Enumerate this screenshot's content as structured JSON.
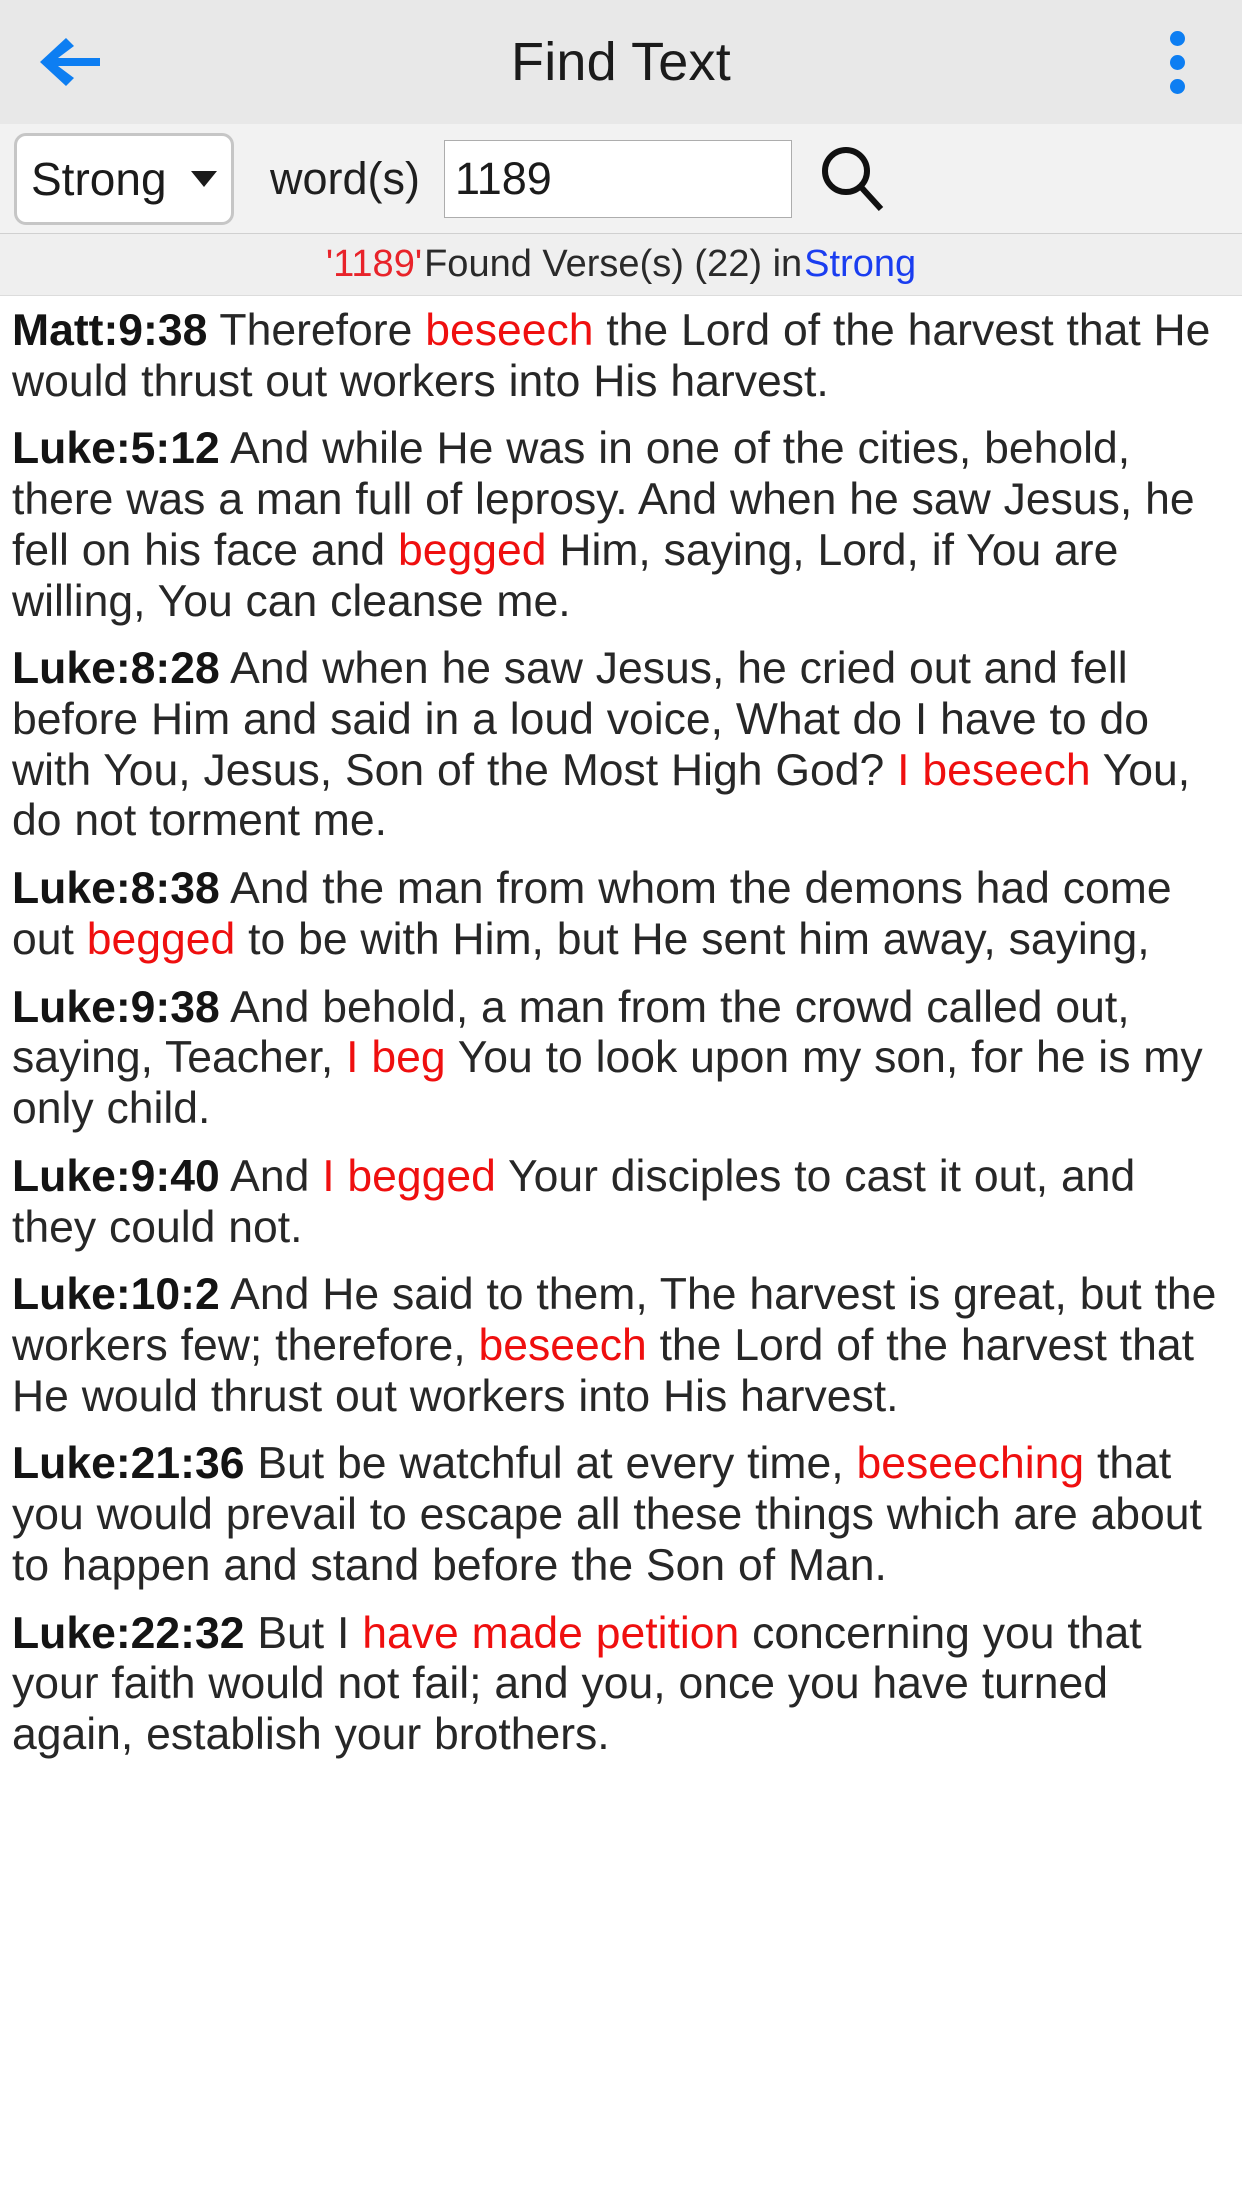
{
  "appbar": {
    "title": "Find Text",
    "back_icon": "arrow-left-icon",
    "overflow_icon": "more-vertical-icon",
    "accent_color": "#0d7ef2"
  },
  "searchbar": {
    "scope_value": "Strong",
    "scope_caret_icon": "chevron-down-icon",
    "words_label": "word(s)",
    "query_value": "1189",
    "query_placeholder": "",
    "search_icon": "search-icon"
  },
  "results": {
    "query_quoted": "'1189'",
    "middle_text": " Found Verse(s) (22) in ",
    "scope": "Strong",
    "count": 22,
    "query_color": "#e8232a",
    "scope_color": "#1a3df0"
  },
  "verses": [
    {
      "ref": "Matt:9:38",
      "parts": [
        {
          "t": " Therefore ",
          "h": false
        },
        {
          "t": "beseech",
          "h": true
        },
        {
          "t": " the Lord of the harvest that He would thrust out workers into His harvest.",
          "h": false
        }
      ]
    },
    {
      "ref": "Luke:5:12",
      "parts": [
        {
          "t": " And while He was in one of the cities, behold, there was a man full of leprosy. And when he saw Jesus, he fell on his face and ",
          "h": false
        },
        {
          "t": "begged",
          "h": true
        },
        {
          "t": " Him, saying, Lord, if You are willing, You can cleanse me.",
          "h": false
        }
      ]
    },
    {
      "ref": "Luke:8:28",
      "parts": [
        {
          "t": " And when he saw Jesus, he cried out and fell before Him and said in a loud voice, What do I have to do with You, Jesus, Son of the Most High God? ",
          "h": false
        },
        {
          "t": "I beseech",
          "h": true
        },
        {
          "t": " You, do not torment me.",
          "h": false
        }
      ]
    },
    {
      "ref": "Luke:8:38",
      "parts": [
        {
          "t": " And the man from whom the demons had come out ",
          "h": false
        },
        {
          "t": "begged",
          "h": true
        },
        {
          "t": " to be with Him, but He sent him away, saying,",
          "h": false
        }
      ]
    },
    {
      "ref": "Luke:9:38",
      "parts": [
        {
          "t": " And behold, a man from the crowd called out, saying, Teacher, ",
          "h": false
        },
        {
          "t": "I beg",
          "h": true
        },
        {
          "t": " You to look upon my son, for he is my only child.",
          "h": false
        }
      ]
    },
    {
      "ref": "Luke:9:40",
      "parts": [
        {
          "t": " And ",
          "h": false
        },
        {
          "t": "I begged",
          "h": true
        },
        {
          "t": " Your disciples to cast it out, and they could not.",
          "h": false
        }
      ]
    },
    {
      "ref": "Luke:10:2",
      "parts": [
        {
          "t": " And He said to them, The harvest is great, but the workers few; therefore, ",
          "h": false
        },
        {
          "t": "beseech",
          "h": true
        },
        {
          "t": " the Lord of the harvest that He would thrust out workers into His harvest.",
          "h": false
        }
      ]
    },
    {
      "ref": "Luke:21:36",
      "parts": [
        {
          "t": " But be watchful at every time, ",
          "h": false
        },
        {
          "t": "beseeching",
          "h": true
        },
        {
          "t": " that you would prevail to escape all these things which are about to happen and stand before the Son of Man.",
          "h": false
        }
      ]
    },
    {
      "ref": "Luke:22:32",
      "parts": [
        {
          "t": " But I ",
          "h": false
        },
        {
          "t": "have made petition",
          "h": true
        },
        {
          "t": " concerning you that your faith would not fail; and you, once you have turned again, establish your brothers.",
          "h": false
        }
      ]
    }
  ]
}
